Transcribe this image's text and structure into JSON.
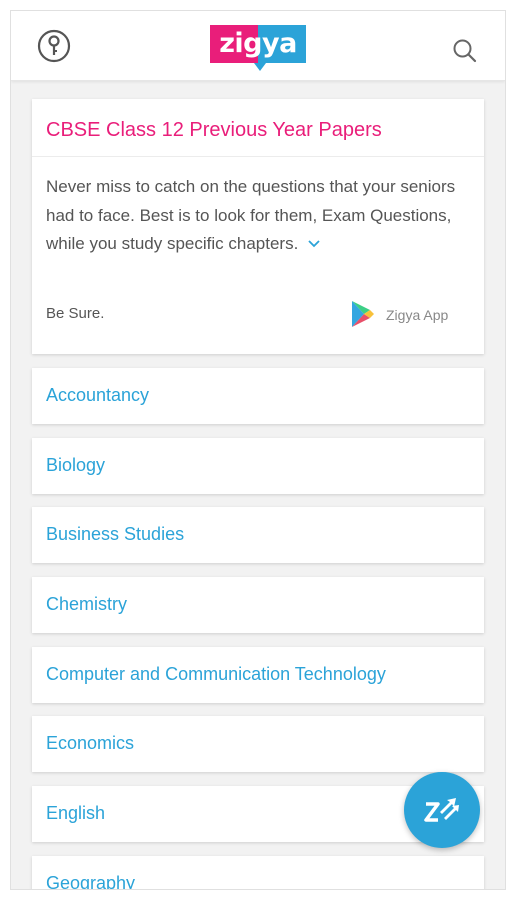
{
  "header": {
    "logo_text": "zigya",
    "brand_pink": "#e91e7a",
    "brand_blue": "#2ba3d8",
    "left_icon": "key-icon",
    "right_icon": "search-icon"
  },
  "intro": {
    "title": "CBSE Class 12 Previous Year Papers",
    "description": "Never miss to catch on the questions that your seniors had to face. Best is to look for them, Exam Questions, while you study specific chapters.",
    "expand_icon": "chevron-down-icon",
    "footer_text": "Be Sure.",
    "app_link_label": "Zigya App",
    "app_icon": "play-store-icon"
  },
  "subjects": [
    "Accountancy",
    "Biology",
    "Business Studies",
    "Chemistry",
    "Computer and Communication Technology",
    "Economics",
    "English",
    "Geography"
  ],
  "fab": {
    "icon": "zigya-z-arrows-icon"
  }
}
